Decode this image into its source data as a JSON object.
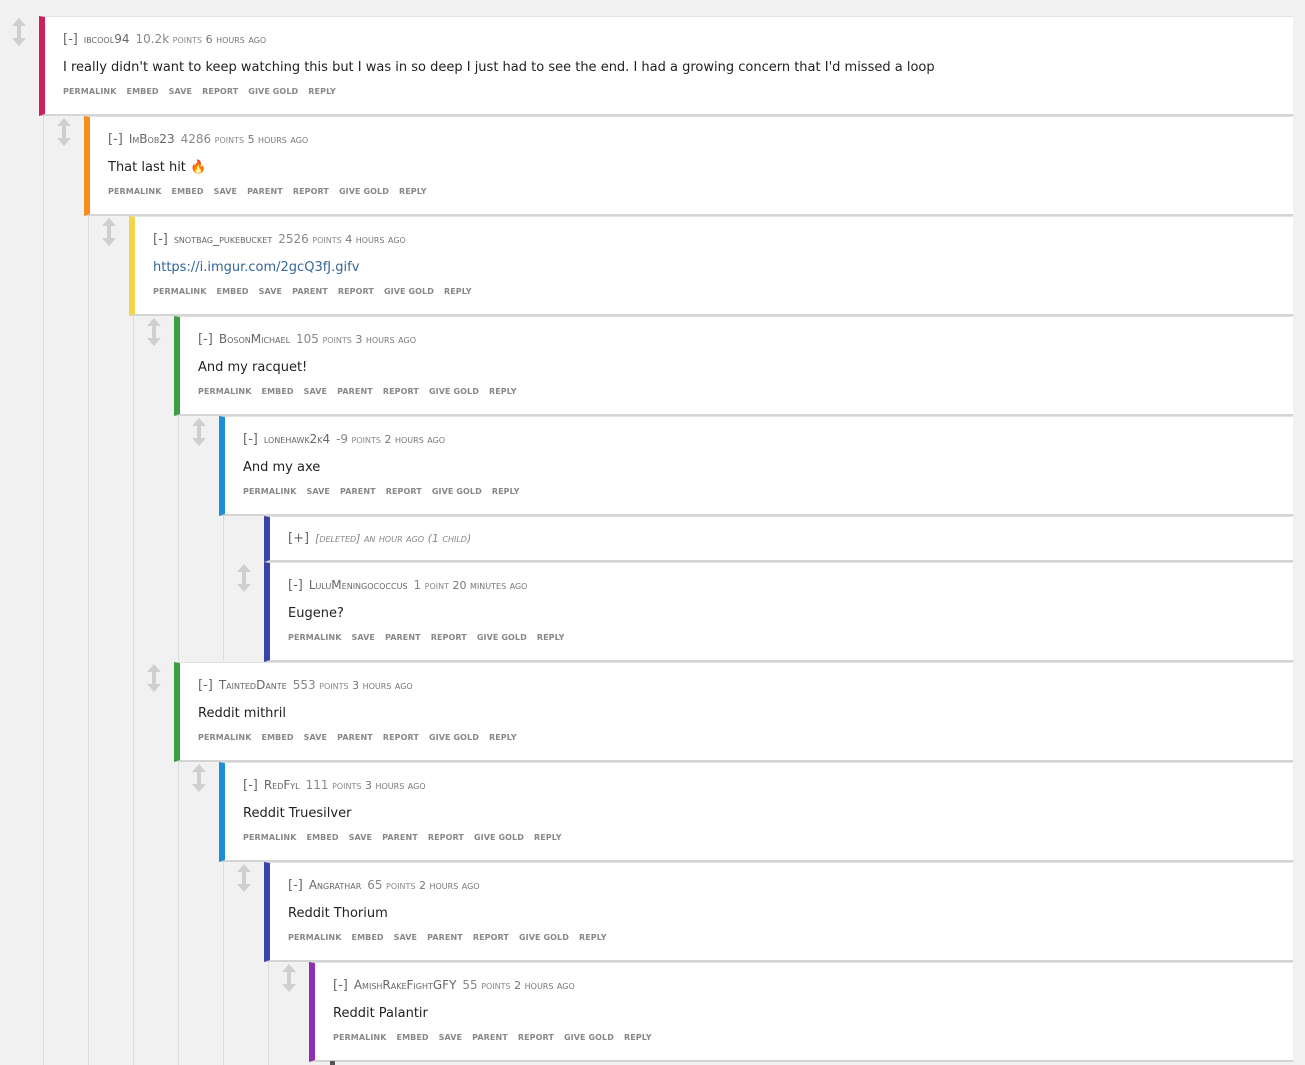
{
  "colors": {
    "depth0": "#cc1f5c",
    "depth1": "#f78c1f",
    "depth2": "#f2d54a",
    "depth3": "#3f9e45",
    "depth4": "#1e8fd6",
    "depth5": "#3a43a6",
    "depth6": "#8e2eb0"
  },
  "comments": [
    {
      "toggle": "[-]",
      "author": "ibcool94",
      "score_num": "10.2k",
      "score_unit": "points",
      "time": "6 hours ago",
      "body": "I really didn't want to keep watching this but I was in so deep I just had to see the end. I had a growing concern that I'd missed a loop",
      "actions": [
        "permalink",
        "embed",
        "save",
        "report",
        "give gold",
        "reply"
      ]
    },
    {
      "toggle": "[-]",
      "author": "ImBob23",
      "score_num": "4286",
      "score_unit": "points",
      "time": "5 hours ago",
      "body": "That last hit 🔥",
      "actions": [
        "permalink",
        "embed",
        "save",
        "parent",
        "report",
        "give gold",
        "reply"
      ]
    },
    {
      "toggle": "[-]",
      "author": "snotbag_pukebucket",
      "score_num": "2526",
      "score_unit": "points",
      "time": "4 hours ago",
      "body": "https://i.imgur.com/2gcQ3fJ.gifv",
      "actions": [
        "permalink",
        "embed",
        "save",
        "parent",
        "report",
        "give gold",
        "reply"
      ]
    },
    {
      "toggle": "[-]",
      "author": "BosonMichael",
      "score_num": "105",
      "score_unit": "points",
      "time": "3 hours ago",
      "body": "And my racquet!",
      "actions": [
        "permalink",
        "embed",
        "save",
        "parent",
        "report",
        "give gold",
        "reply"
      ]
    },
    {
      "toggle": "[-]",
      "author": "lonehawk2k4",
      "score_num": "-9",
      "score_unit": "points",
      "time": "2 hours ago",
      "body": "And my axe",
      "actions": [
        "permalink",
        "save",
        "parent",
        "report",
        "give gold",
        "reply"
      ]
    },
    {
      "toggle": "[+]",
      "deleted": "[deleted] an hour ago (1 child)"
    },
    {
      "toggle": "[-]",
      "author": "LuluMeningococcus",
      "score_num": "1",
      "score_unit": "point",
      "time": "20 minutes ago",
      "body": "Eugene?",
      "actions": [
        "permalink",
        "save",
        "parent",
        "report",
        "give gold",
        "reply"
      ]
    },
    {
      "toggle": "[-]",
      "author": "TaintedDante",
      "score_num": "553",
      "score_unit": "points",
      "time": "3 hours ago",
      "body": "Reddit mithril",
      "actions": [
        "permalink",
        "embed",
        "save",
        "parent",
        "report",
        "give gold",
        "reply"
      ]
    },
    {
      "toggle": "[-]",
      "author": "RedFyl",
      "score_num": "111",
      "score_unit": "points",
      "time": "3 hours ago",
      "body": "Reddit Truesilver",
      "actions": [
        "permalink",
        "embed",
        "save",
        "parent",
        "report",
        "give gold",
        "reply"
      ]
    },
    {
      "toggle": "[-]",
      "author": "Angrathar",
      "score_num": "65",
      "score_unit": "points",
      "time": "2 hours ago",
      "body": "Reddit Thorium",
      "actions": [
        "permalink",
        "embed",
        "save",
        "parent",
        "report",
        "give gold",
        "reply"
      ]
    },
    {
      "toggle": "[-]",
      "author": "AmishRakeFightGFY",
      "score_num": "55",
      "score_unit": "points",
      "time": "2 hours ago",
      "body": "Reddit Palantir",
      "actions": [
        "permalink",
        "embed",
        "save",
        "parent",
        "report",
        "give gold",
        "reply"
      ]
    }
  ]
}
